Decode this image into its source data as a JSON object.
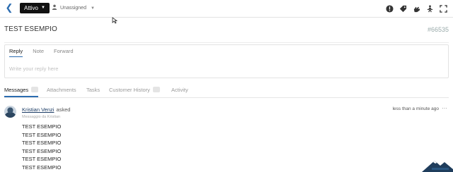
{
  "toolbar": {
    "status_label": "Attivo",
    "assignee_label": "Unassigned"
  },
  "ticket": {
    "title": "TEST ESEMPIO",
    "number": "#66535"
  },
  "reply": {
    "tabs": [
      "Reply",
      "Note",
      "Forward"
    ],
    "placeholder": "Write your reply here"
  },
  "message_tabs": [
    "Messages",
    "Attachments",
    "Tasks",
    "Customer History",
    "Activity"
  ],
  "message": {
    "author": "Kristian Venzi",
    "action": "asked",
    "meta": "Messaggio da Kristian",
    "time": "less than a minute ago",
    "lines": [
      "TEST ESEMPIO",
      "TEST ESEMPIO",
      "TEST ESEMPIO",
      "TEST ESEMPIO",
      "TEST ESEMPIO",
      "TEST ESEMPIO"
    ]
  },
  "colors": {
    "accent": "#2b6cb0",
    "status_bg": "#111111",
    "author_link": "#1d3d66"
  },
  "icons": [
    "back-chevron-icon",
    "person-icon",
    "alert-icon",
    "tag-icon",
    "hand-icon",
    "walking-person-icon",
    "expand-icon",
    "more-dots-icon"
  ]
}
